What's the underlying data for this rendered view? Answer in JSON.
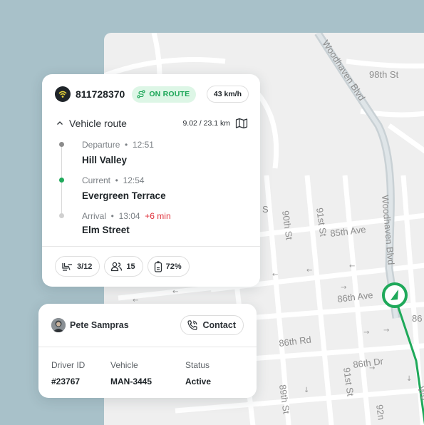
{
  "map": {
    "streets": {
      "woodhaven_top": "Woodhaven Blvd",
      "s98": "98th St",
      "s_edge": "S",
      "s90": "90th St",
      "s91a": "91st St",
      "ave85": "85th Ave",
      "woodhaven_mid": "Woodhaven Blvd",
      "ave86": "86th Ave",
      "s86_edge": "86",
      "rd86": "86th Rd",
      "dr86": "86th Dr",
      "s91b": "91st St",
      "s89": "89th St",
      "s92": "92n",
      "wo_edge": "Wo"
    },
    "route_color": "#1fa95a"
  },
  "vehicle": {
    "id": "811728370",
    "status": "ON ROUTE",
    "speed": "43 km/h",
    "route_title": "Vehicle route",
    "distance": "9.02 / 23.1 km",
    "stops": [
      {
        "label": "Departure",
        "time": "12:51",
        "name": "Hill Valley",
        "dot_color": "#8c8c8c"
      },
      {
        "label": "Current",
        "time": "12:54",
        "name": "Evergreen Terrace",
        "dot_color": "#1fa95a"
      },
      {
        "label": "Arrival",
        "time": "13:04",
        "delay": "+6 min",
        "name": "Elm Street",
        "dot_color": "#d0d0d0"
      }
    ],
    "stats": [
      {
        "icon": "seats-icon",
        "value": "3/12"
      },
      {
        "icon": "passengers-icon",
        "value": "15"
      },
      {
        "icon": "battery-icon",
        "value": "72%"
      }
    ]
  },
  "driver": {
    "name": "Pete Sampras",
    "contact_label": "Contact",
    "fields": [
      {
        "label": "Driver ID",
        "value": "#23767"
      },
      {
        "label": "Vehicle",
        "value": "MAN-3445"
      },
      {
        "label": "Status",
        "value": "Active"
      }
    ]
  }
}
